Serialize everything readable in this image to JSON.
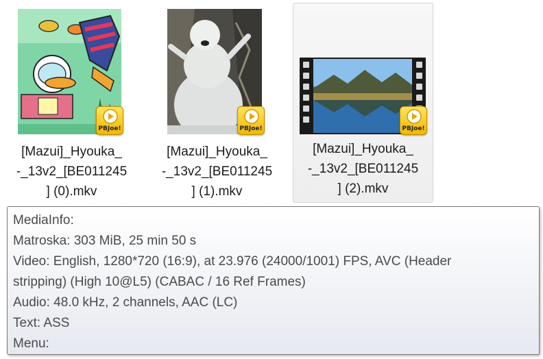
{
  "files": [
    {
      "name_lines": [
        "[Mazui]_Hyouka_",
        "-_13v2_[BE011245",
        "] (0).mkv"
      ],
      "selected": false,
      "badge_label": "PBJoe!"
    },
    {
      "name_lines": [
        "[Mazui]_Hyouka_",
        "-_13v2_[BE011245",
        "] (1).mkv"
      ],
      "selected": false,
      "badge_label": "PBJoe!"
    },
    {
      "name_lines": [
        "[Mazui]_Hyouka_",
        "-_13v2_[BE011245",
        "] (2).mkv"
      ],
      "selected": true,
      "badge_label": "PBJoe!"
    }
  ],
  "tooltip": {
    "lines": [
      "MediaInfo:",
      "Matroska: 303 MiB, 25 min 50 s",
      "Video: English, 1280*720 (16:9), at 23.976 (24000/1001) FPS, AVC (Header",
      "stripping) (High 10@L5) (CABAC / 16 Ref Frames)",
      "Audio: 48.0 kHz, 2 channels, AAC (LC)",
      "Text: ASS",
      "Menu:"
    ]
  },
  "colors": {
    "badge": "#f5c400",
    "selection_border": "#d6d6d6",
    "tooltip_border": "#767676"
  }
}
